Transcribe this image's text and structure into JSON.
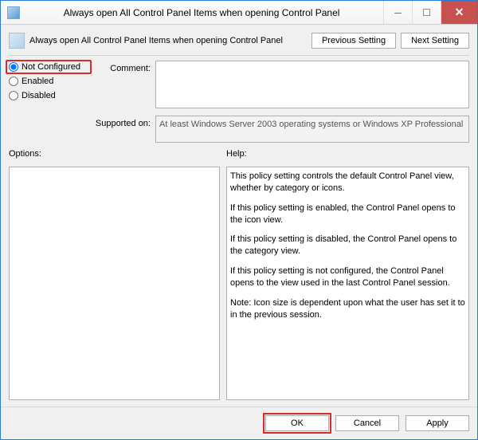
{
  "window": {
    "title": "Always open All Control Panel Items when opening Control Panel"
  },
  "header": {
    "policy_name": "Always open All Control Panel Items when opening Control Panel",
    "prev_btn": "Previous Setting",
    "next_btn": "Next Setting"
  },
  "state": {
    "not_configured": "Not Configured",
    "enabled": "Enabled",
    "disabled": "Disabled",
    "selected": "not_configured"
  },
  "labels": {
    "comment": "Comment:",
    "supported": "Supported on:",
    "options": "Options:",
    "help": "Help:"
  },
  "comment_value": "",
  "supported_value": "At least Windows Server 2003 operating systems or Windows XP Professional",
  "options_content": "",
  "help_paragraphs": {
    "p1": "This policy setting controls the default Control Panel view, whether by category or icons.",
    "p2": "If this policy setting is enabled, the Control Panel opens to the icon view.",
    "p3": "If this policy setting is disabled, the Control Panel opens to the category view.",
    "p4": "If this policy setting is not configured, the Control Panel opens to the view used in the last Control Panel session.",
    "p5": "Note: Icon size is dependent upon what the user has set it to in the previous session."
  },
  "footer": {
    "ok": "OK",
    "cancel": "Cancel",
    "apply": "Apply"
  }
}
